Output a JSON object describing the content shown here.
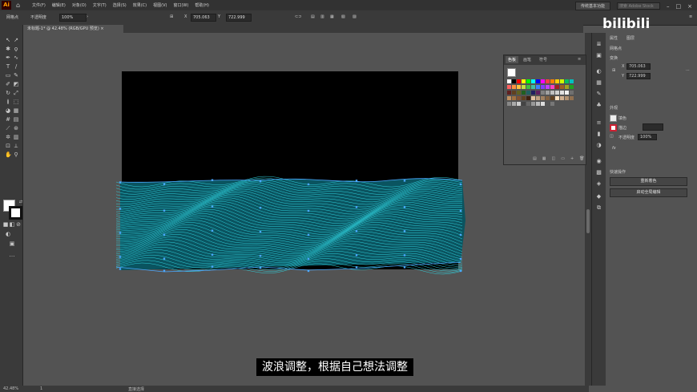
{
  "app": {
    "logo": "Ai",
    "home_icon": "home-icon"
  },
  "menu": {
    "items": [
      "文件(F)",
      "编辑(E)",
      "对象(O)",
      "文字(T)",
      "选择(S)",
      "效果(C)",
      "视图(V)",
      "窗口(W)",
      "帮助(H)"
    ],
    "workspace": "传统基本功能",
    "search_placeholder": "搜索 Adobe Stock"
  },
  "control_bar": {
    "selection_label": "网格点",
    "opacity_label": "不透明度",
    "opacity_value": "100%",
    "x_label": "X",
    "x_value": "705.063",
    "y_label": "Y",
    "y_value": "722.999"
  },
  "document": {
    "tab_title": "未标题-1* @ 42.48% (RGB/GPU 预览)"
  },
  "color_panel": {
    "tabs": [
      "色板",
      "画笔",
      "符号"
    ],
    "active_tab": "色板"
  },
  "properties_panel": {
    "tabs": [
      "属性",
      "图层"
    ],
    "section_selection": "网格点",
    "section_transform": "变换",
    "x_label": "X",
    "x_value": "705.063",
    "y_label": "Y",
    "y_value": "722.999",
    "section_appearance": "外观",
    "fill_label": "填色",
    "stroke_label": "描边",
    "opacity_label": "不透明度",
    "opacity_value": "100%",
    "fx_label": "fx",
    "section_quick_actions": "快速操作",
    "recolor_button": "重新着色",
    "global_edit_button": "启动全局编辑"
  },
  "status_bar": {
    "zoom": "42.48%",
    "page": "1",
    "tool_name": "直接选择"
  },
  "subtitle": "波浪调整，根据自己想法调整",
  "watermark": "bilibili",
  "colors": {
    "accent": "#2ec8d4",
    "artboard": "#000000",
    "ui_dark": "#323232",
    "ui_mid": "#3a3a3a",
    "canvas": "#535353"
  }
}
